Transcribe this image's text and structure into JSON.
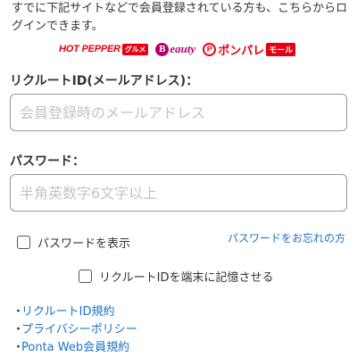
{
  "intro": {
    "text": "すでに下記サイトなどで会員登録されている方も、こちらからログインできます。"
  },
  "logos": {
    "hotpepper": {
      "name": "HOT PEPPER",
      "sub": "グルメ"
    },
    "beauty": {
      "mark": "B",
      "name": "eauty"
    },
    "ponpare": {
      "mark": "P",
      "name": "ポンパレ",
      "sub": "モール"
    }
  },
  "form": {
    "id_label": "リクルートID(メールアドレス)：",
    "id_placeholder": "会員登録時のメールアドレス",
    "pw_label": "パスワード：",
    "pw_placeholder": "半角英数字6文字以上",
    "show_password_label": "パスワードを表示",
    "forgot_password_label": "パスワードをお忘れの方",
    "remember_id_label": "リクルートIDを端末に記憶させる"
  },
  "links": [
    {
      "label": "リクルートID規約"
    },
    {
      "label": "プライバシーポリシー"
    },
    {
      "label": "Ponta Web会員規約"
    }
  ],
  "colors": {
    "link": "#1a73c8",
    "brand_red": "#e60012",
    "brand_beauty": "#b5006b",
    "input_border": "#999999"
  }
}
